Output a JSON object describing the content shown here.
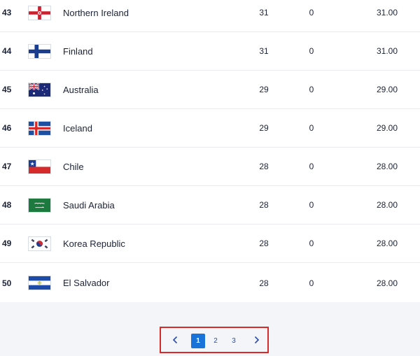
{
  "rows": [
    {
      "rank": "43",
      "country": "Northern Ireland",
      "flag": "northern-ireland-flag",
      "c1": "31",
      "c2": "0",
      "c3": "31.00"
    },
    {
      "rank": "44",
      "country": "Finland",
      "flag": "finland-flag",
      "c1": "31",
      "c2": "0",
      "c3": "31.00"
    },
    {
      "rank": "45",
      "country": "Australia",
      "flag": "australia-flag",
      "c1": "29",
      "c2": "0",
      "c3": "29.00"
    },
    {
      "rank": "46",
      "country": "Iceland",
      "flag": "iceland-flag",
      "c1": "29",
      "c2": "0",
      "c3": "29.00"
    },
    {
      "rank": "47",
      "country": "Chile",
      "flag": "chile-flag",
      "c1": "28",
      "c2": "0",
      "c3": "28.00"
    },
    {
      "rank": "48",
      "country": "Saudi Arabia",
      "flag": "saudi-arabia-flag",
      "c1": "28",
      "c2": "0",
      "c3": "28.00"
    },
    {
      "rank": "49",
      "country": "Korea Republic",
      "flag": "korea-republic-flag",
      "c1": "28",
      "c2": "0",
      "c3": "28.00"
    },
    {
      "rank": "50",
      "country": "El Salvador",
      "flag": "el-salvador-flag",
      "c1": "28",
      "c2": "0",
      "c3": "28.00"
    }
  ],
  "pagination": {
    "prev_icon": "chevron-left-icon",
    "next_icon": "chevron-right-icon",
    "pages": [
      "1",
      "2",
      "3"
    ],
    "active_page": "1"
  },
  "colors": {
    "accent": "#1a73d9",
    "highlight_box": "#d62b2b",
    "page_background": "#f3f5f9"
  }
}
